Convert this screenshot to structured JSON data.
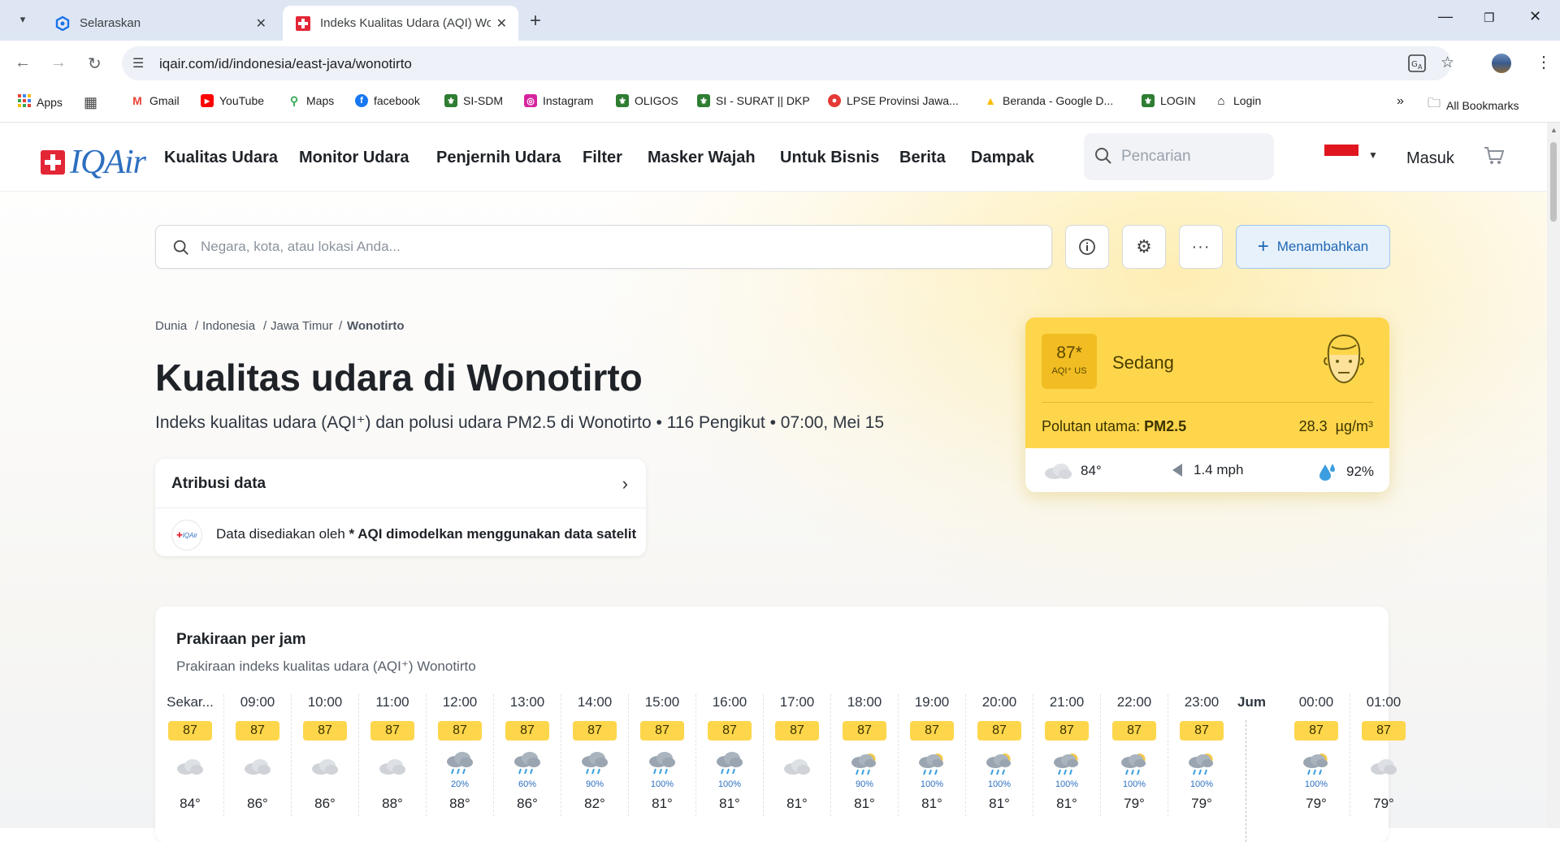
{
  "browser": {
    "tabs": [
      {
        "title": "Selaraskan",
        "active": false
      },
      {
        "title": "Indeks Kualitas Udara (AQI) Wonotirto",
        "active": true
      }
    ],
    "url": "iqair.com/id/indonesia/east-java/wonotirto",
    "bookmarks": [
      "Apps",
      "Gmail",
      "YouTube",
      "Maps",
      "facebook",
      "SI-SDM",
      "Instagram",
      "OLIGOS",
      "SI - SURAT || DKP",
      "LPSE Provinsi Jawa...",
      "Beranda - Google D...",
      "LOGIN",
      "Login"
    ],
    "all_bookmarks": "All Bookmarks"
  },
  "site": {
    "logo": "IQAir",
    "nav": [
      "Kualitas Udara",
      "Monitor Udara",
      "Penjernih Udara",
      "Filter",
      "Masker Wajah",
      "Untuk Bisnis",
      "Berita",
      "Dampak"
    ],
    "search_placeholder": "Pencarian",
    "login": "Masuk"
  },
  "search": {
    "placeholder": "Negara, kota, atau lokasi Anda...",
    "add_label": "Menambahkan"
  },
  "breadcrumb": [
    "Dunia",
    "Indonesia",
    "Jawa Timur",
    "Wonotirto"
  ],
  "title": "Kualitas udara di Wonotirto",
  "subtitle": "Indeks kualitas udara (AQI⁺) dan polusi udara PM2.5 di Wonotirto • 116 Pengikut • 07:00, Mei 15",
  "attribution": {
    "title": "Atribusi data",
    "text_prefix": "Data disediakan oleh",
    "text_bold": "* AQI dimodelkan menggunakan data satelit"
  },
  "aqi": {
    "value": "87*",
    "unit": "AQI⁺ US",
    "level": "Sedang",
    "pollutant_label": "Polutan utama:",
    "pollutant": "PM2.5",
    "concentration": "28.3",
    "conc_unit": "µg/m³",
    "temp": "84°",
    "wind": "1.4 mph",
    "humidity": "92%",
    "color": "#fdd64b"
  },
  "forecast": {
    "title": "Prakiraan per jam",
    "subtitle": "Prakiraan indeks kualitas udara (AQI⁺) Wonotirto",
    "day_label": "Jum",
    "hours": [
      {
        "time": "Sekar...",
        "aqi": "87",
        "icon": "cloud",
        "rain": "",
        "temp": "84°"
      },
      {
        "time": "09:00",
        "aqi": "87",
        "icon": "cloud",
        "rain": "",
        "temp": "86°"
      },
      {
        "time": "10:00",
        "aqi": "87",
        "icon": "cloud",
        "rain": "",
        "temp": "86°"
      },
      {
        "time": "11:00",
        "aqi": "87",
        "icon": "cloud",
        "rain": "",
        "temp": "88°"
      },
      {
        "time": "12:00",
        "aqi": "87",
        "icon": "rain",
        "rain": "20%",
        "temp": "88°"
      },
      {
        "time": "13:00",
        "aqi": "87",
        "icon": "rain",
        "rain": "60%",
        "temp": "86°"
      },
      {
        "time": "14:00",
        "aqi": "87",
        "icon": "rain",
        "rain": "90%",
        "temp": "82°"
      },
      {
        "time": "15:00",
        "aqi": "87",
        "icon": "rain",
        "rain": "100%",
        "temp": "81°"
      },
      {
        "time": "16:00",
        "aqi": "87",
        "icon": "rain",
        "rain": "100%",
        "temp": "81°"
      },
      {
        "time": "17:00",
        "aqi": "87",
        "icon": "cloud",
        "rain": "",
        "temp": "81°"
      },
      {
        "time": "18:00",
        "aqi": "87",
        "icon": "night-rain",
        "rain": "90%",
        "temp": "81°"
      },
      {
        "time": "19:00",
        "aqi": "87",
        "icon": "night-rain",
        "rain": "100%",
        "temp": "81°"
      },
      {
        "time": "20:00",
        "aqi": "87",
        "icon": "night-rain",
        "rain": "100%",
        "temp": "81°"
      },
      {
        "time": "21:00",
        "aqi": "87",
        "icon": "night-rain",
        "rain": "100%",
        "temp": "81°"
      },
      {
        "time": "22:00",
        "aqi": "87",
        "icon": "night-rain",
        "rain": "100%",
        "temp": "79°"
      },
      {
        "time": "23:00",
        "aqi": "87",
        "icon": "night-rain",
        "rain": "100%",
        "temp": "79°"
      },
      {
        "time": "00:00",
        "aqi": "87",
        "icon": "night-rain",
        "rain": "100%",
        "temp": "79°"
      },
      {
        "time": "01:00",
        "aqi": "87",
        "icon": "cloud",
        "rain": "",
        "temp": "79°"
      }
    ]
  }
}
